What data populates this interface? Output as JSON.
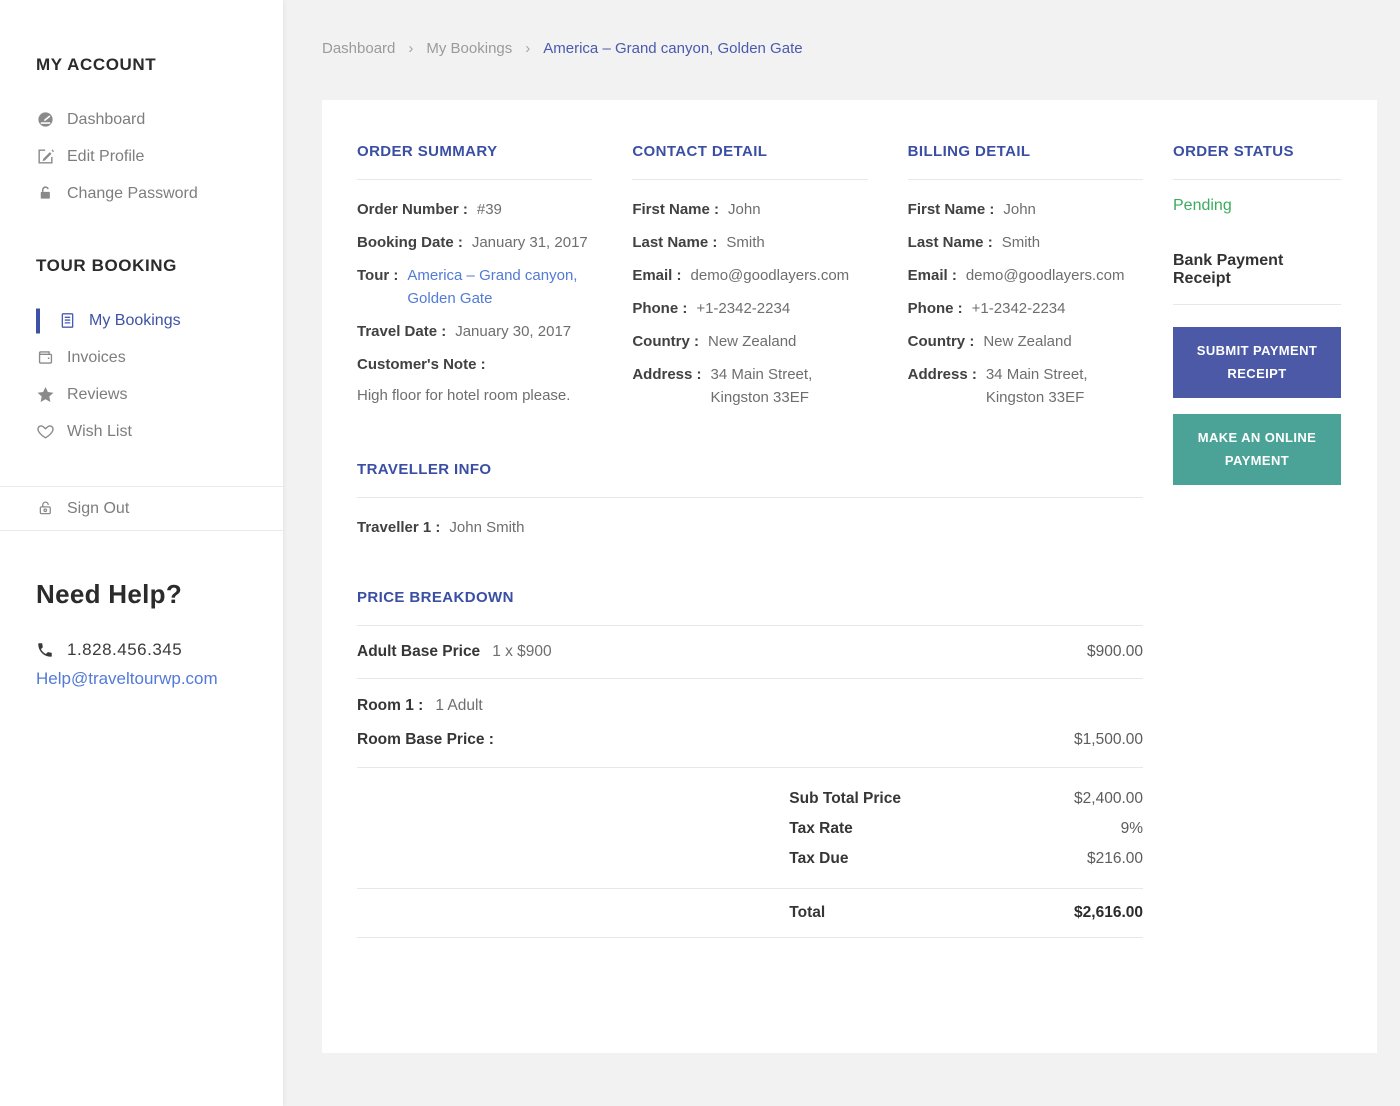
{
  "colors": {
    "accent_indigo": "#3d52a5",
    "link_blue": "#527ad6",
    "status_green": "#3cab5f",
    "button_blue": "#4c59a7",
    "button_teal": "#4aa396"
  },
  "sidebar": {
    "account_title": "MY ACCOUNT",
    "account_items": [
      {
        "label": "Dashboard",
        "icon": "gauge-icon"
      },
      {
        "label": "Edit Profile",
        "icon": "edit-icon"
      },
      {
        "label": "Change Password",
        "icon": "lock-icon"
      }
    ],
    "booking_title": "TOUR BOOKING",
    "booking_items": [
      {
        "label": "My Bookings",
        "icon": "bookings-icon",
        "active": true
      },
      {
        "label": "Invoices",
        "icon": "wallet-icon"
      },
      {
        "label": "Reviews",
        "icon": "star-icon"
      },
      {
        "label": "Wish List",
        "icon": "heart-icon"
      }
    ],
    "sign_out": "Sign Out",
    "help_title": "Need Help?",
    "help_phone": "1.828.456.345",
    "help_email": "Help@traveltourwp.com"
  },
  "breadcrumb": {
    "item1": "Dashboard",
    "item2": "My Bookings",
    "current": "America – Grand canyon, Golden Gate",
    "separator": "›"
  },
  "order_summary": {
    "title": "ORDER SUMMARY",
    "rows": [
      {
        "label": "Order Number :",
        "value": "#39"
      },
      {
        "label": "Booking Date :",
        "value": "January 31, 2017"
      },
      {
        "label": "Tour :",
        "value": "America – Grand canyon, Golden Gate"
      },
      {
        "label": "Travel Date :",
        "value": "January 30, 2017"
      },
      {
        "label": "Customer's Note :",
        "value": ""
      }
    ],
    "note": "High floor for hotel room please."
  },
  "contact_detail": {
    "title": "CONTACT DETAIL",
    "rows": [
      {
        "label": "First Name :",
        "value": "John"
      },
      {
        "label": "Last Name :",
        "value": "Smith"
      },
      {
        "label": "Email :",
        "value": "demo@goodlayers.com"
      },
      {
        "label": "Phone :",
        "value": "+1-2342-2234"
      },
      {
        "label": "Country :",
        "value": "New Zealand"
      },
      {
        "label": "Address :",
        "value": "34 Main Street, Kingston 33EF"
      }
    ]
  },
  "billing_detail": {
    "title": "BILLING DETAIL",
    "rows": [
      {
        "label": "First Name :",
        "value": "John"
      },
      {
        "label": "Last Name :",
        "value": "Smith"
      },
      {
        "label": "Email :",
        "value": "demo@goodlayers.com"
      },
      {
        "label": "Phone :",
        "value": "+1-2342-2234"
      },
      {
        "label": "Country :",
        "value": "New Zealand"
      },
      {
        "label": "Address :",
        "value": "34 Main Street, Kingston 33EF"
      }
    ]
  },
  "traveller_info": {
    "title": "TRAVELLER INFO",
    "label": "Traveller 1 :",
    "value": "John Smith"
  },
  "price_breakdown": {
    "title": "PRICE BREAKDOWN",
    "adult_label": "Adult Base Price",
    "adult_qty": "1 x $900",
    "adult_amount": "$900.00",
    "room_label": "Room 1 :",
    "room_value": "1 Adult",
    "room_price_label": "Room Base Price :",
    "room_price_amount": "$1,500.00",
    "subtotal_label": "Sub Total Price",
    "subtotal_amount": "$2,400.00",
    "tax_rate_label": "Tax Rate",
    "tax_rate_amount": "9%",
    "tax_due_label": "Tax Due",
    "tax_due_amount": "$216.00",
    "total_label": "Total",
    "total_amount": "$2,616.00"
  },
  "order_status": {
    "title": "ORDER STATUS",
    "status": "Pending",
    "receipt_title": "Bank Payment Receipt",
    "submit_button": "SUBMIT PAYMENT RECEIPT",
    "online_button": "MAKE AN ONLINE PAYMENT"
  }
}
